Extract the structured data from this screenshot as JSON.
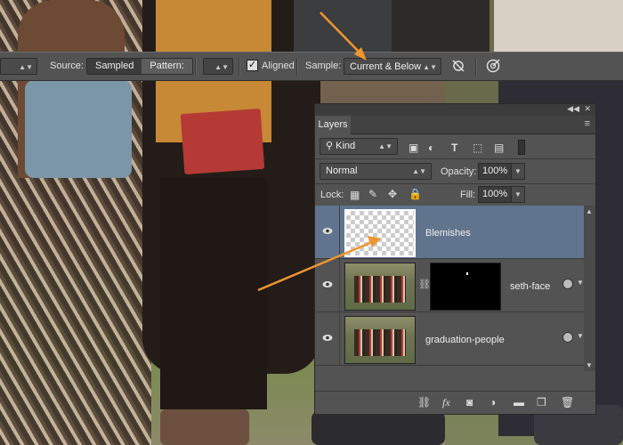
{
  "options_bar": {
    "source_label": "Source:",
    "source_sampled": "Sampled",
    "source_pattern": "Pattern:",
    "aligned_label": "Aligned",
    "aligned_checked": true,
    "sample_label": "Sample:",
    "sample_value": "Current & Below"
  },
  "layers_panel": {
    "tab_label": "Layers",
    "filter_kind": "Kind",
    "blend_mode": "Normal",
    "opacity_label": "Opacity:",
    "opacity_value": "100%",
    "lock_label": "Lock:",
    "fill_label": "Fill:",
    "fill_value": "100%",
    "layers": [
      {
        "name": "Blemishes",
        "selected": true,
        "visible": true
      },
      {
        "name": "seth-face",
        "selected": false,
        "visible": true
      },
      {
        "name": "graduation-people",
        "selected": false,
        "visible": true
      }
    ]
  },
  "colors": {
    "toolbar_bg": "#535353",
    "panel_bg": "#535353",
    "selected_layer": "#61748d",
    "annotation_arrow": "#f0962e",
    "diploma_red": "#b53a35"
  },
  "icons": [
    "search-icon",
    "image-filter-icon",
    "adjustment-filter-icon",
    "type-filter-icon",
    "shape-filter-icon",
    "smart-object-filter-icon",
    "lock-transparency-icon",
    "lock-brush-icon",
    "lock-move-icon",
    "lock-all-icon",
    "eye-icon",
    "link-chain-icon",
    "link-layers-icon",
    "fx-icon",
    "mask-icon",
    "adjustment-icon",
    "folder-icon",
    "new-layer-icon",
    "trash-icon",
    "ignore-adjustments-icon",
    "pressure-icon"
  ]
}
